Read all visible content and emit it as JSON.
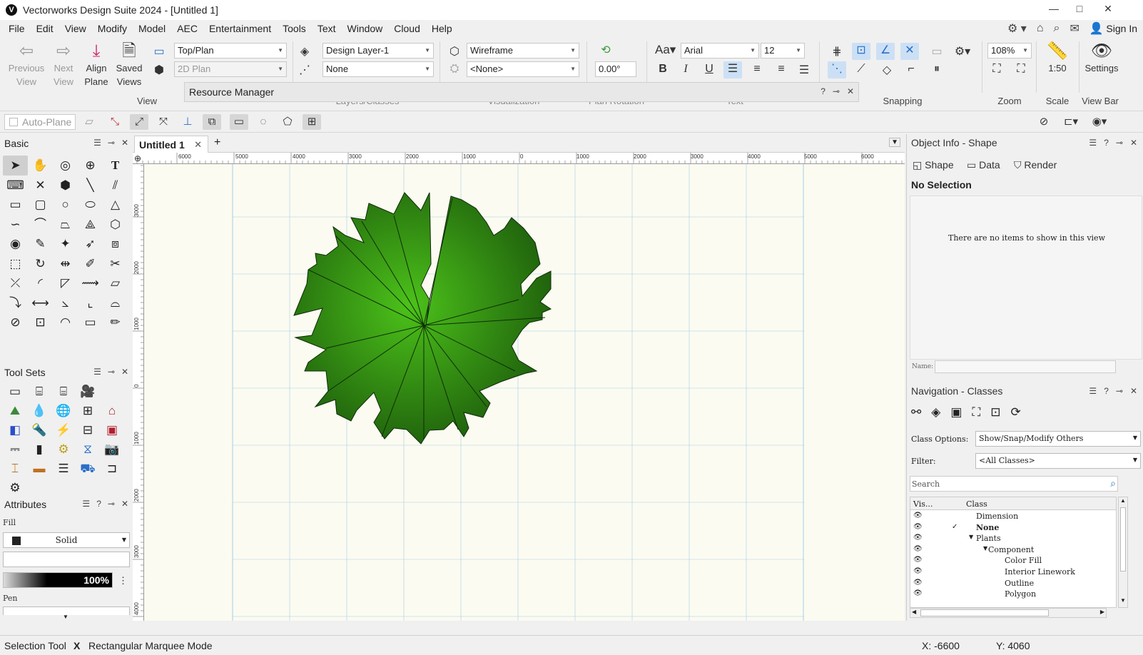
{
  "window": {
    "title": "Vectorworks Design Suite 2024 - [Untitled 1]",
    "logo": "V",
    "controls": [
      "—",
      "□",
      "✕"
    ]
  },
  "menu": [
    "File",
    "Edit",
    "View",
    "Modify",
    "Model",
    "AEC",
    "Entertainment",
    "Tools",
    "Text",
    "Window",
    "Cloud",
    "Help"
  ],
  "menu_right": {
    "sign_in": "Sign In"
  },
  "ribbon": {
    "previous_view": "Previous View",
    "next_view": "Next View",
    "align_plane": "Align Plane",
    "saved_views": "Saved Views",
    "view_group": "View",
    "view_dd": "Top/Plan",
    "render_dd": "2D Plan",
    "layer_dd": "Design Layer-1",
    "class_dd": "None",
    "layers_classes_group": "Layers/Classes",
    "vis_dd": "Wireframe",
    "vis_none_dd": "<None>",
    "visualization_group": "Visualization",
    "plan_rotation": "0.00°",
    "plan_rotation_group": "Plan Rotation",
    "font_dd": "Arial",
    "font_size_dd": "12",
    "text_group": "Text",
    "snapping_group": "Snapping",
    "zoom_value": "108%",
    "zoom_group": "Zoom",
    "scale_value": "1:50",
    "scale_group": "Scale",
    "settings_label": "Settings",
    "viewbar_group": "View Bar"
  },
  "resource_manager": {
    "title": "Resource Manager"
  },
  "toolbar2": {
    "auto_plane": "Auto-Plane"
  },
  "basic_palette": {
    "title": "Basic"
  },
  "toolsets_palette": {
    "title": "Tool Sets"
  },
  "attributes": {
    "title": "Attributes",
    "fill_label": "Fill",
    "fill_style": "Solid",
    "opacity": "100%",
    "pen_label": "Pen"
  },
  "doc": {
    "tab": "Untitled 1"
  },
  "rulers": {
    "top": [
      "6000",
      "5000",
      "4000",
      "3000",
      "2000",
      "1000",
      "0",
      "1000",
      "2000",
      "3000",
      "4000",
      "5000",
      "6000"
    ],
    "left": [
      "3000",
      "2000",
      "1000",
      "0",
      "1000",
      "2000",
      "3000",
      "4000"
    ]
  },
  "object_info": {
    "title": "Object Info - Shape",
    "tabs": [
      "Shape",
      "Data",
      "Render"
    ],
    "selection": "No Selection",
    "empty_message": "There are no items to show in this view",
    "name_label": "Name:"
  },
  "navigation": {
    "title": "Navigation - Classes",
    "class_options_label": "Class Options:",
    "class_options_value": "Show/Snap/Modify Others",
    "filter_label": "Filter:",
    "filter_value": "<All Classes>",
    "search_placeholder": "Search",
    "col_vis": "Vis...",
    "col_class": "Class",
    "classes": [
      {
        "name": "Dimension",
        "indent": 0,
        "bold": false,
        "check": false,
        "arrow": ""
      },
      {
        "name": "None",
        "indent": 0,
        "bold": true,
        "check": true,
        "arrow": ""
      },
      {
        "name": "Plants",
        "indent": 0,
        "bold": false,
        "check": false,
        "arrow": "▼"
      },
      {
        "name": "Component",
        "indent": 1,
        "bold": false,
        "check": false,
        "arrow": "▼"
      },
      {
        "name": "Color Fill",
        "indent": 2,
        "bold": false,
        "check": false,
        "arrow": ""
      },
      {
        "name": "Interior Linework",
        "indent": 2,
        "bold": false,
        "check": false,
        "arrow": ""
      },
      {
        "name": "Outline",
        "indent": 2,
        "bold": false,
        "check": false,
        "arrow": ""
      },
      {
        "name": "Polygon",
        "indent": 2,
        "bold": false,
        "check": false,
        "arrow": ""
      }
    ]
  },
  "status": {
    "tool": "Selection Tool",
    "mode_key": "X",
    "mode": "Rectangular Marquee Mode",
    "x": "X: -6600",
    "y": "Y: 4060"
  },
  "colors": {
    "accent": "#cce0f5",
    "plant_light": "#4cc21a",
    "plant_dark": "#1d5c0c",
    "grid": "#a7cde6",
    "canvas": "#fbfbf1"
  }
}
